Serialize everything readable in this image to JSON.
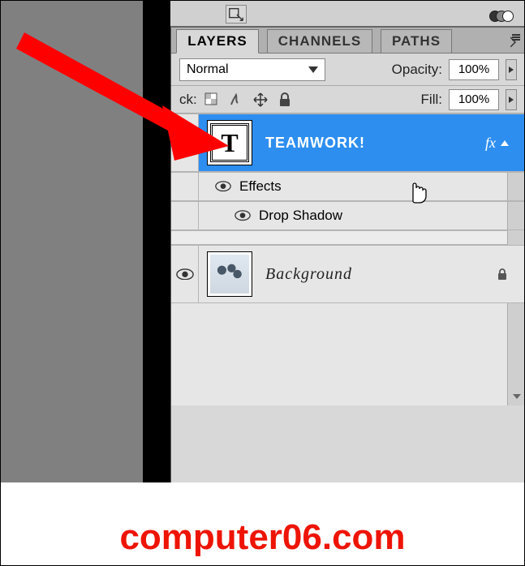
{
  "tabs": {
    "layers": "LAYERS",
    "channels": "CHANNELS",
    "paths": "PATHS"
  },
  "blend": {
    "mode": "Normal",
    "opacity_label": "Opacity:",
    "opacity_value": "100%"
  },
  "lockrow": {
    "label_suffix": "ck:",
    "fill_label": "Fill:",
    "fill_value": "100%"
  },
  "layers": {
    "text": {
      "name": "TEAMWORK!",
      "fx_label": "fx",
      "thumb_glyph": "T"
    },
    "effects_label": "Effects",
    "dropshadow_label": "Drop Shadow",
    "background": {
      "name": "Background"
    }
  },
  "watermark": "computer06.com"
}
